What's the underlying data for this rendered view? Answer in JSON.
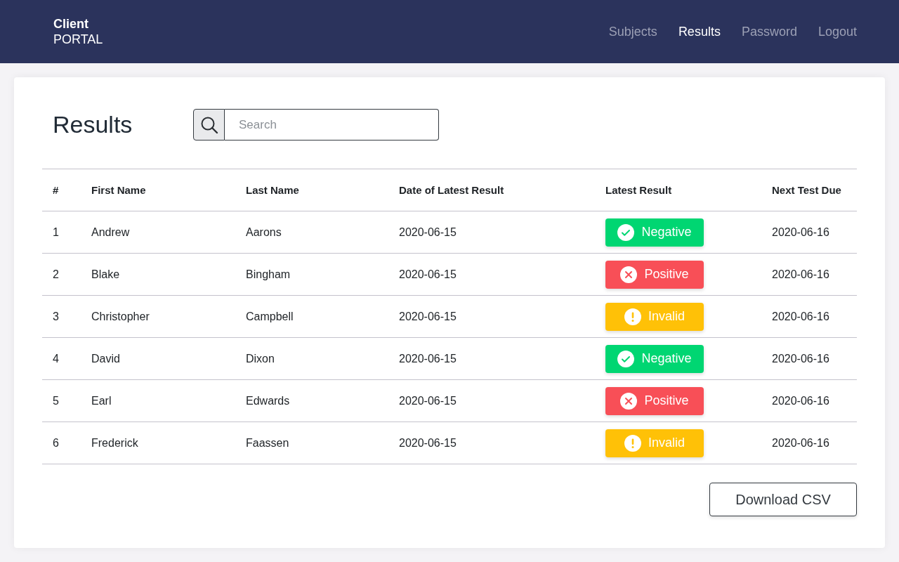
{
  "brand": {
    "name": "Client",
    "sub": "PORTAL"
  },
  "nav": [
    {
      "label": "Subjects",
      "selected": false
    },
    {
      "label": "Results",
      "selected": true
    },
    {
      "label": "Password",
      "selected": false
    },
    {
      "label": "Logout",
      "selected": false
    }
  ],
  "page_title": "Results",
  "search": {
    "placeholder": "Search"
  },
  "table": {
    "columns": [
      "#",
      "First Name",
      "Last Name",
      "Date of Latest Result",
      "Latest Result",
      "Next Test Due"
    ],
    "rows": [
      {
        "num": "1",
        "first": "Andrew",
        "last": "Aarons",
        "date": "2020-06-15",
        "result": {
          "kind": "negative",
          "label": "Negative"
        },
        "next": "2020-06-16"
      },
      {
        "num": "2",
        "first": "Blake",
        "last": "Bingham",
        "date": "2020-06-15",
        "result": {
          "kind": "positive",
          "label": "Positive"
        },
        "next": "2020-06-16"
      },
      {
        "num": "3",
        "first": "Christopher",
        "last": "Campbell",
        "date": "2020-06-15",
        "result": {
          "kind": "invalid",
          "label": "Invalid"
        },
        "next": "2020-06-16"
      },
      {
        "num": "4",
        "first": "David",
        "last": "Dixon",
        "date": "2020-06-15",
        "result": {
          "kind": "negative",
          "label": "Negative"
        },
        "next": "2020-06-16"
      },
      {
        "num": "5",
        "first": "Earl",
        "last": "Edwards",
        "date": "2020-06-15",
        "result": {
          "kind": "positive",
          "label": "Positive"
        },
        "next": "2020-06-16"
      },
      {
        "num": "6",
        "first": "Frederick",
        "last": "Faassen",
        "date": "2020-06-15",
        "result": {
          "kind": "invalid",
          "label": "Invalid"
        },
        "next": "2020-06-16"
      }
    ]
  },
  "download_button": "Download CSV"
}
